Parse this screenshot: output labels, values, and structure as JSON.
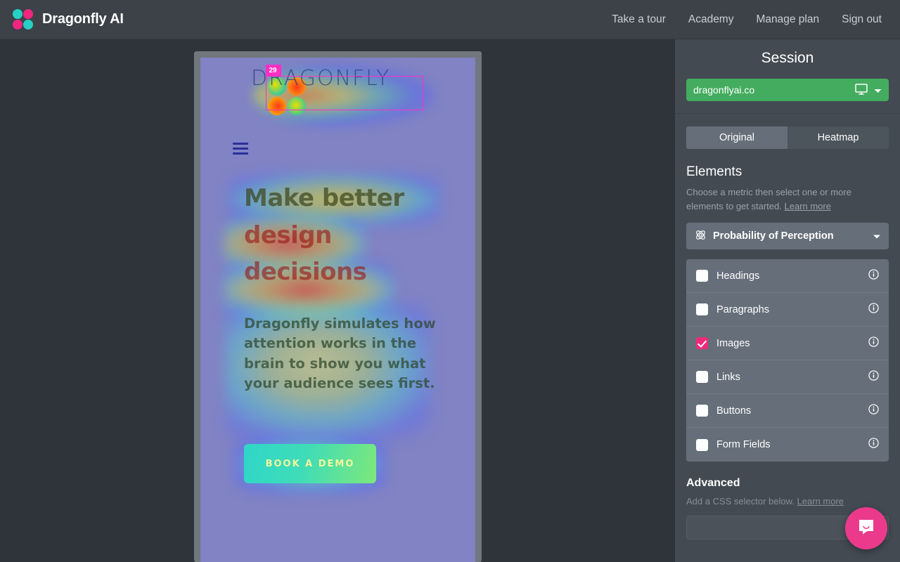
{
  "header": {
    "brand_name": "Dragonfly AI",
    "logo_colors": {
      "teal": "#26d0c4",
      "pink": "#f0267f"
    },
    "nav": [
      {
        "label": "Take a tour",
        "name": "nav-take-a-tour"
      },
      {
        "label": "Academy",
        "name": "nav-academy"
      },
      {
        "label": "Manage plan",
        "name": "nav-manage-plan"
      },
      {
        "label": "Sign out",
        "name": "nav-sign-out"
      }
    ]
  },
  "preview": {
    "site_wordmark": "DRAGONFLY",
    "selection_badge": "29",
    "selection_color": "#ff2ec4",
    "headline": {
      "line1": "Make better",
      "line2": "design",
      "line3": "decisions"
    },
    "paragraph": "Dragonfly simulates how attention works in the brain to show you what your audience sees first.",
    "cta_label": "BOOK A DEMO",
    "background_color": "#8183c4"
  },
  "sidebar": {
    "title": "Session",
    "session_url": "dragonflyai.co",
    "session_color": "#44ac5f",
    "view_tabs": [
      {
        "label": "Original",
        "active": true
      },
      {
        "label": "Heatmap",
        "active": false
      }
    ],
    "elements": {
      "title": "Elements",
      "help_text": "Choose a metric then select one or more elements to get started.",
      "help_link": "Learn more",
      "metric": "Probability of Perception",
      "items": [
        {
          "label": "Headings",
          "checked": false
        },
        {
          "label": "Paragraphs",
          "checked": false
        },
        {
          "label": "Images",
          "checked": true
        },
        {
          "label": "Links",
          "checked": false
        },
        {
          "label": "Buttons",
          "checked": false
        },
        {
          "label": "Form Fields",
          "checked": false
        }
      ],
      "checked_color": "#ef2a7b"
    },
    "advanced": {
      "title": "Advanced",
      "help_text": "Add a CSS selector below.",
      "help_link": "Learn more",
      "input_value": ""
    },
    "chat_color": "#eb3a8c"
  }
}
